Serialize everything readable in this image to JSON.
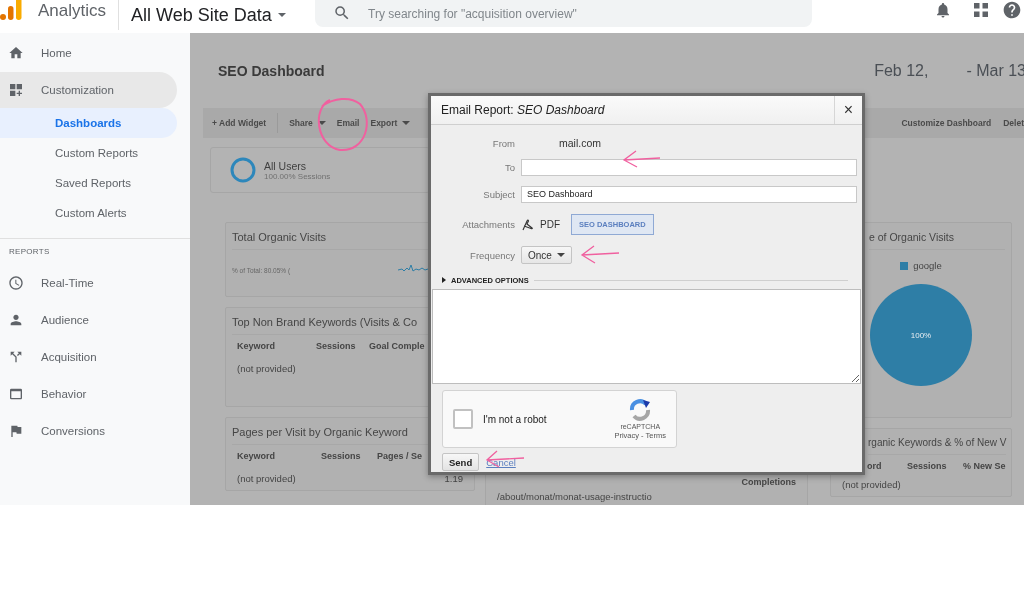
{
  "header": {
    "product": "Analytics",
    "property": "All Web Site Data",
    "search": {
      "placeholder": "Try searching for \"acquisition overview\""
    }
  },
  "sidebar": {
    "items": [
      {
        "label": "Home",
        "expanded": false
      },
      {
        "label": "Customization",
        "expanded": true,
        "children": [
          {
            "label": "Dashboards",
            "selected": true
          },
          {
            "label": "Custom Reports",
            "selected": false
          },
          {
            "label": "Saved Reports",
            "selected": false
          },
          {
            "label": "Custom Alerts",
            "selected": false
          }
        ]
      }
    ],
    "section": {
      "heading": "REPORTS",
      "items": [
        {
          "label": "Real-Time"
        },
        {
          "label": "Audience"
        },
        {
          "label": "Acquisition"
        },
        {
          "label": "Behavior"
        },
        {
          "label": "Conversions"
        }
      ]
    }
  },
  "dashboard": {
    "title": "SEO Dashboard",
    "date_start": "Feb 12,",
    "date_end": "- Mar 13",
    "toolbar": {
      "left": [
        {
          "label": "+ Add Widget",
          "dropdown": false
        },
        {
          "label": "Share",
          "dropdown": true
        },
        {
          "label": "Email",
          "dropdown": false
        },
        {
          "label": "Export",
          "dropdown": true
        }
      ],
      "right": [
        "Customize Dashboard",
        "Delet"
      ]
    },
    "segment": {
      "name": "All Users",
      "detail": "100.00% Sessions"
    },
    "column_1": [
      {
        "kind": "metric",
        "title": "Total Organic Visits",
        "detail": "% of Total: 80.05% ("
      },
      {
        "kind": "table",
        "title": "Top Non Brand Keywords (Visits & Co",
        "columns": [
          "Keyword",
          "Sessions",
          "Goal Comple"
        ],
        "rows": [
          {
            "keyword": "(not provided)"
          }
        ]
      },
      {
        "kind": "table",
        "title": "Pages per Visit by Organic Keyword",
        "columns": [
          "Keyword",
          "Sessions",
          "Pages / Se"
        ],
        "rows": [
          {
            "keyword": "(not provided)",
            "value": "1.19"
          }
        ]
      }
    ],
    "column_2": [
      {
        "kind": "table",
        "columns": [
          "Completions"
        ],
        "rows": [
          {
            "keyword": "/about/monat/monat-usage-instructio"
          }
        ]
      }
    ],
    "column_3": [
      {
        "kind": "pie",
        "title": "e of Organic Visits",
        "chart_data": {
          "type": "pie",
          "categories": [
            "google"
          ],
          "values": [
            100
          ],
          "data_labels": true,
          "value_labels": [
            "100%"
          ]
        }
      },
      {
        "kind": "table",
        "title": "rganic Keywords & % of New V",
        "columns": [
          "ord",
          "Sessions",
          "% New Se"
        ],
        "rows": [
          {
            "keyword": "(not provided)"
          }
        ]
      }
    ]
  },
  "email_dialog": {
    "title": "Email Report: *SEO Dashboard*",
    "close": "×",
    "fields": [
      {
        "kind": "text",
        "label": "From",
        "value": "mail.com"
      },
      {
        "kind": "input",
        "label": "To"
      },
      {
        "kind": "input",
        "label": "Subject",
        "value": "SEO Dashboard"
      },
      {
        "kind": "attachments",
        "label": "Attachments",
        "format": "PDF",
        "attachment": "SEO DASHBOARD"
      },
      {
        "kind": "select",
        "label": "Frequency",
        "value": "Once"
      }
    ],
    "advanced_options": {
      "label": "ADVANCED OPTIONS",
      "expanded": false
    },
    "captcha": {
      "label": "I'm not a robot",
      "checked": false,
      "brand": "reCAPTCHA",
      "links": "Privacy - Terms"
    },
    "buttons": {
      "send": "Send",
      "cancel": "Cancel"
    }
  }
}
